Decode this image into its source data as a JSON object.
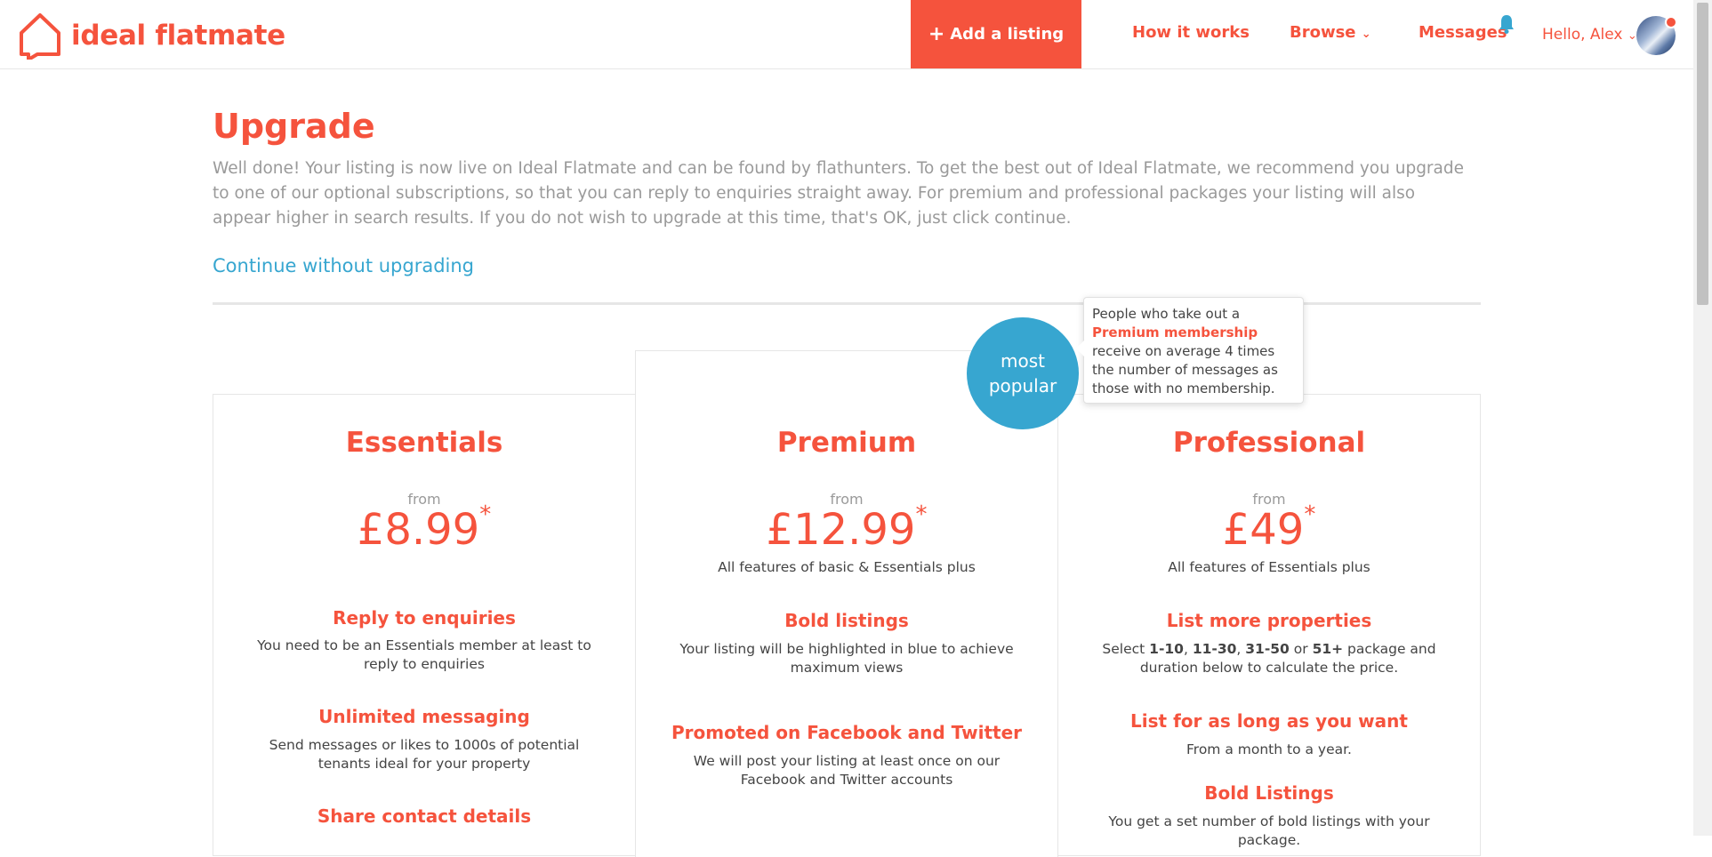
{
  "nav": {
    "logo_text": "ideal flatmate",
    "add_listing": "Add a listing",
    "how_it_works": "How it works",
    "browse": "Browse",
    "messages": "Messages",
    "hello": "Hello, Alex"
  },
  "page": {
    "title": "Upgrade",
    "intro": "Well done! Your listing is now live on Ideal Flatmate and can be found by flathunters. To get the best out of Ideal Flatmate, we recommend you upgrade to one of our optional subscriptions, so that you can reply to enquiries straight away. For premium and professional packages your listing will also appear higher in search results. If you do not wish to upgrade at this time, that's OK, just click continue.",
    "continue_link": "Continue without upgrading"
  },
  "badge": {
    "line1": "most",
    "line2": "popular"
  },
  "tooltip": {
    "pre": "People who take out a",
    "highlight": "Premium membership",
    "post": "receive on average 4 times the number of messages as those with no membership."
  },
  "plans": [
    {
      "name": "Essentials",
      "from": "from",
      "price": "£8.99",
      "asterisk": "*",
      "subtitle": "",
      "features": [
        {
          "title": "Reply to enquiries",
          "desc": "You need to be an Essentials member at least to reply to enquiries"
        },
        {
          "title": "Unlimited messaging",
          "desc": "Send messages or likes to 1000s of potential tenants ideal for your property"
        },
        {
          "title": "Share contact details",
          "desc": ""
        }
      ]
    },
    {
      "name": "Premium",
      "from": "from",
      "price": "£12.99",
      "asterisk": "*",
      "subtitle": "All features of basic & Essentials plus",
      "features": [
        {
          "title": "Bold listings",
          "desc": "Your listing will be highlighted in blue to achieve maximum views"
        },
        {
          "title": "Promoted on Facebook and Twitter",
          "desc": "We will post your listing at least once on our Facebook and Twitter accounts"
        }
      ]
    },
    {
      "name": "Professional",
      "from": "from",
      "price": "£49",
      "asterisk": "*",
      "subtitle": "All features of Essentials plus",
      "features": [
        {
          "title": "List more properties",
          "desc_pre": "Select ",
          "opt1": "1-10",
          "sep1": ", ",
          "opt2": "11-30",
          "sep2": ", ",
          "opt3": "31-50",
          "sep3": " or ",
          "opt4": "51+",
          "desc_post": " package and duration below to calculate the price."
        },
        {
          "title": "List for as long as you want",
          "desc": "From a month to a year."
        },
        {
          "title": "Bold Listings",
          "desc": "You get a set number of bold listings with your package."
        }
      ]
    }
  ],
  "colors": {
    "brand": "#f5533d",
    "accent": "#37a6d0"
  }
}
